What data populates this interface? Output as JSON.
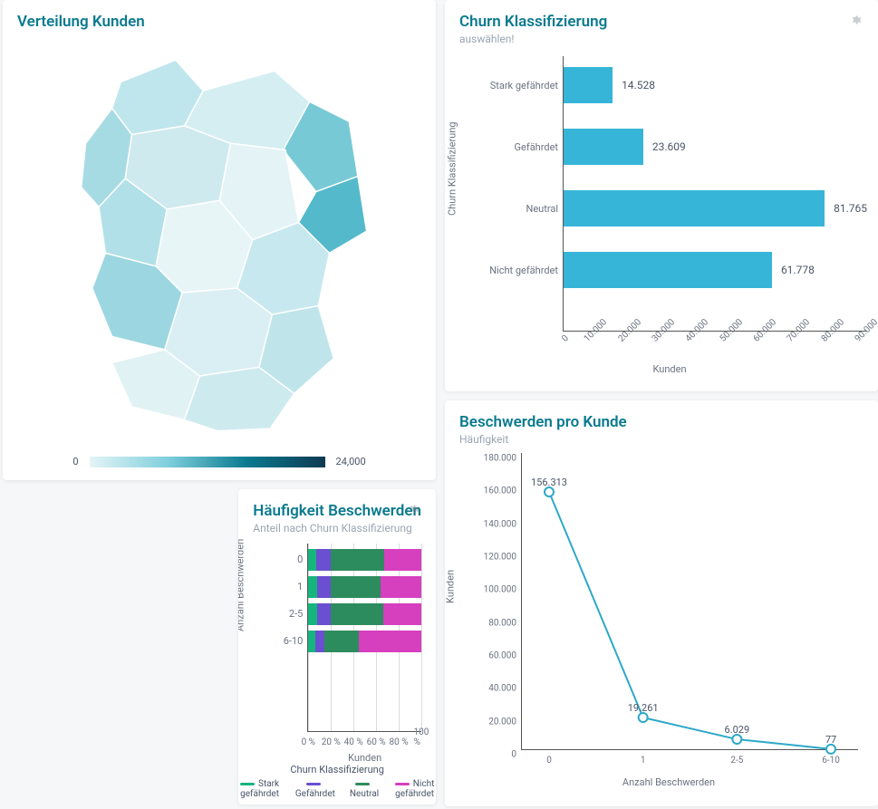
{
  "cards": {
    "churn": {
      "title": "Churn Klassifizierung",
      "subtitle": "auswählen!",
      "ylabel": "Churn Klassifizierung",
      "xlabel": "Kunden"
    },
    "map": {
      "title": "Verteilung Kunden",
      "legend_min": "0",
      "legend_max": "24,000"
    },
    "complaints": {
      "title": "Beschwerden pro Kunde",
      "subtitle": "Häufigkeit",
      "ylabel": "Kunden",
      "xlabel": "Anzahl Beschwerden"
    },
    "freq": {
      "title": "Häufigkeit Beschwerden",
      "subtitle": "Anteil nach Churn Klassifizierung",
      "ylabel": "Anzahl Beschwerden",
      "xlabel": "Kunden",
      "legend_title": "Churn Klassifizierung",
      "legend": [
        "Stark gefährdet",
        "Gefährdet",
        "Neutral",
        "Nicht gefährdet"
      ]
    }
  },
  "chart_data": [
    {
      "id": "churn_klassifizierung",
      "type": "bar",
      "orientation": "horizontal",
      "title": "Churn Klassifizierung",
      "xlabel": "Kunden",
      "ylabel": "Churn Klassifizierung",
      "categories": [
        "Stark gefährdet",
        "Gefährdet",
        "Neutral",
        "Nicht gefährdet"
      ],
      "values": [
        14528,
        23609,
        81765,
        61778
      ],
      "value_labels": [
        "14.528",
        "23.609",
        "81.765",
        "61.778"
      ],
      "xlim": [
        0,
        90000
      ],
      "xticks": [
        0,
        10000,
        20000,
        30000,
        40000,
        50000,
        60000,
        70000,
        80000,
        90000
      ],
      "xtick_labels": [
        "0",
        "10.000",
        "20.000",
        "30.000",
        "40.000",
        "50.000",
        "60.000",
        "70.000",
        "80.000",
        "90.000"
      ]
    },
    {
      "id": "verteilung_kunden",
      "type": "heatmap",
      "title": "Verteilung Kunden",
      "description": "Choroplethenkarte Deutschland, Kundenzahl pro Region",
      "legend_range": [
        0,
        24000
      ]
    },
    {
      "id": "beschwerden_pro_kunde",
      "type": "line",
      "title": "Beschwerden pro Kunde",
      "xlabel": "Anzahl Beschwerden",
      "ylabel": "Kunden",
      "x": [
        "0",
        "1",
        "2-5",
        "6-10"
      ],
      "y": [
        156313,
        19261,
        6029,
        77
      ],
      "y_labels": [
        "156.313",
        "19.261",
        "6.029",
        "77"
      ],
      "ylim": [
        0,
        180000
      ],
      "yticks": [
        0,
        20000,
        40000,
        60000,
        80000,
        100000,
        120000,
        140000,
        160000,
        180000
      ],
      "ytick_labels": [
        "0",
        "20.000",
        "40.000",
        "60.000",
        "80.000",
        "100.000",
        "120.000",
        "140.000",
        "160.000",
        "180.000"
      ]
    },
    {
      "id": "haeufigkeit_beschwerden",
      "type": "bar",
      "orientation": "horizontal",
      "stacked": true,
      "normalized_percent": true,
      "title": "Häufigkeit Beschwerden",
      "xlabel": "Kunden",
      "ylabel": "Anzahl Beschwerden",
      "categories": [
        "0",
        "1",
        "2-5",
        "6-10"
      ],
      "series": [
        {
          "name": "Stark gefährdet",
          "color": "#17b57e",
          "values": [
            7,
            8,
            8,
            6
          ]
        },
        {
          "name": "Gefährdet",
          "color": "#6a4fd0",
          "values": [
            13,
            12,
            12,
            8
          ]
        },
        {
          "name": "Neutral",
          "color": "#2d8c5d",
          "values": [
            47,
            44,
            46,
            31
          ]
        },
        {
          "name": "Nicht gefährdet",
          "color": "#d63fbd",
          "values": [
            33,
            36,
            34,
            55
          ]
        }
      ],
      "xticks": [
        0,
        20,
        40,
        60,
        80,
        100
      ],
      "xtick_labels": [
        "0 %",
        "20 %",
        "40 %",
        "60 %",
        "80 %",
        "100 %"
      ]
    }
  ]
}
